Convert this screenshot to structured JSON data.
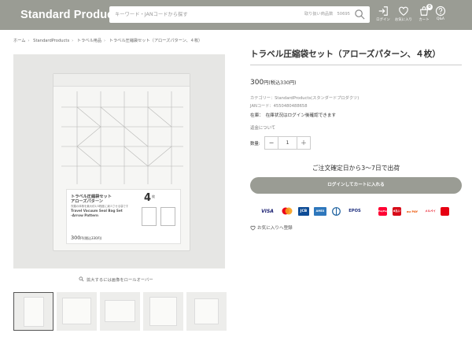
{
  "header": {
    "logo": "Standard Products",
    "search_placeholder": "キーワード・JANコードから探す",
    "search_hint": "取り扱い商品数　50695",
    "icons": [
      {
        "name": "login-icon",
        "label": "ログイン"
      },
      {
        "name": "favorite-icon",
        "label": "お気に入り"
      },
      {
        "name": "cart-icon",
        "label": "カート",
        "badge": "0"
      },
      {
        "name": "qa-icon",
        "label": "Q&A"
      }
    ]
  },
  "breadcrumb": [
    "ホーム",
    "StandardProducts",
    "トラベル用品",
    "トラベル圧縮袋セット（アローズパターン、４枚）"
  ],
  "gallery": {
    "zoom_hint": "拡大するには画像をロールオーバー",
    "package": {
      "jp_title_1": "トラベル圧縮袋セット",
      "jp_title_2": "アローズパターン",
      "jp_note": "衣類の体積を最大約1/3程度に減少させる袋です",
      "en_title_1": "Travel Vacuum Seal Bag Set",
      "en_title_2": "-Arrow Pattern",
      "count": "4",
      "count_unit": "枚",
      "price": "300",
      "price_tax": "円(税込330円)"
    },
    "thumbnails": 5
  },
  "product": {
    "title": "トラベル圧縮袋セット（アローズパターン、４枚）",
    "price": "300",
    "price_suffix": "円(税込330円)",
    "category": "カテゴリー：StandardProducts(スタンダードプロダクツ)",
    "jan": "JANコード：4550480488658",
    "stock": "在庫：　在庫状況はログイン後確認できます",
    "returns": "返金について",
    "qty_label": "数量:",
    "qty_minus": "−",
    "qty_value": "1",
    "qty_plus": "＋",
    "shipping": "ご注文確定日から3〜7日で出荷",
    "cart_button": "ログインしてカートに入れる",
    "payments": [
      "VISA",
      "Mastercard",
      "JCB",
      "AMEX",
      "Diners",
      "EPOS",
      "PayPay",
      "d払い",
      "au PAY",
      "メルペイ"
    ],
    "favorite": "お気に入りへ登録"
  }
}
